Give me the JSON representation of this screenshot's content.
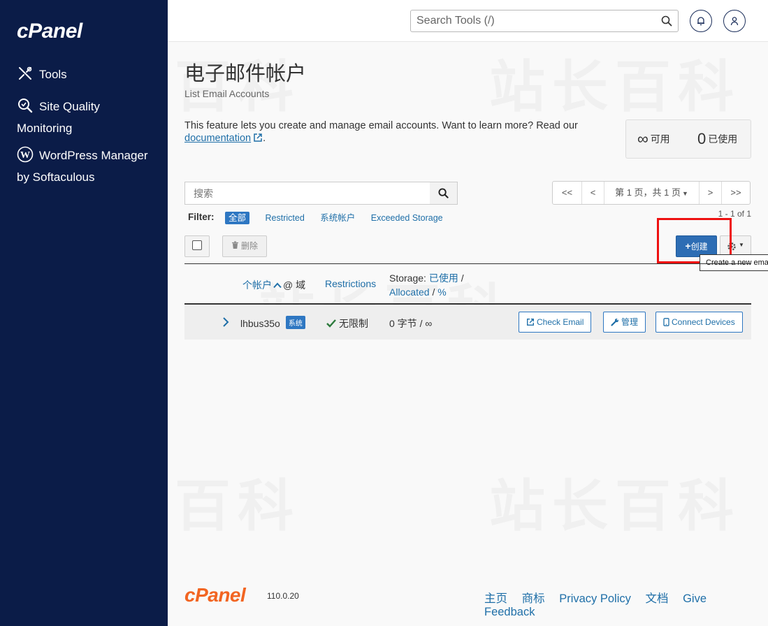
{
  "sidebar": {
    "logo": "cPanel",
    "items": [
      {
        "label": "Tools"
      },
      {
        "label": "Site Quality Monitoring"
      },
      {
        "label": "WordPress Manager by Softaculous"
      }
    ]
  },
  "header": {
    "search_placeholder": "Search Tools (/)"
  },
  "page": {
    "title": "电子邮件帐户",
    "subtitle": "List Email Accounts",
    "intro_text": "This feature lets you create and manage email accounts. Want to learn more? Read our",
    "intro_link": "documentation",
    "intro_end": ".",
    "stats": {
      "available_value": "∞",
      "available_label": "可用",
      "used_value": "0",
      "used_label": "已使用"
    }
  },
  "list": {
    "search_placeholder": "搜索",
    "pager": {
      "first": "<<",
      "prev": "<",
      "page_label": "第 1 页，共 1 页",
      "next": ">",
      "last": ">>"
    },
    "count": "1 - 1 of 1",
    "filter": {
      "label": "Filter:",
      "options": [
        "全部",
        "Restricted",
        "系统帐户",
        "Exceeded Storage"
      ]
    },
    "delete_label": "删除",
    "create_label": "创建",
    "tooltip": "Create a new email",
    "columns": {
      "account": "个帐户",
      "at_domain": "@ 域",
      "restrictions": "Restrictions",
      "storage_prefix": "Storage:",
      "storage_used": "已使用",
      "storage_sep": "/",
      "storage_allocated": "Allocated",
      "storage_sep2": "/",
      "storage_pct": "%"
    },
    "rows": [
      {
        "account": "lhbus35o",
        "tag": "系统",
        "restriction": "无限制",
        "storage": "0 字节 / ∞",
        "check_email": "Check Email",
        "manage": "管理",
        "connect": "Connect Devices"
      }
    ]
  },
  "footer": {
    "logo": "cPanel",
    "version": "110.0.20",
    "links": [
      "主页",
      "商标",
      "Privacy Policy",
      "文档",
      "Give Feedback"
    ]
  },
  "watermark": "站长百科",
  "colors": {
    "sidebar_bg": "#0b1c48",
    "accent": "#2e77c2",
    "link": "#1f6fa8",
    "brand_orange": "#f26522",
    "highlight": "#e11111"
  }
}
